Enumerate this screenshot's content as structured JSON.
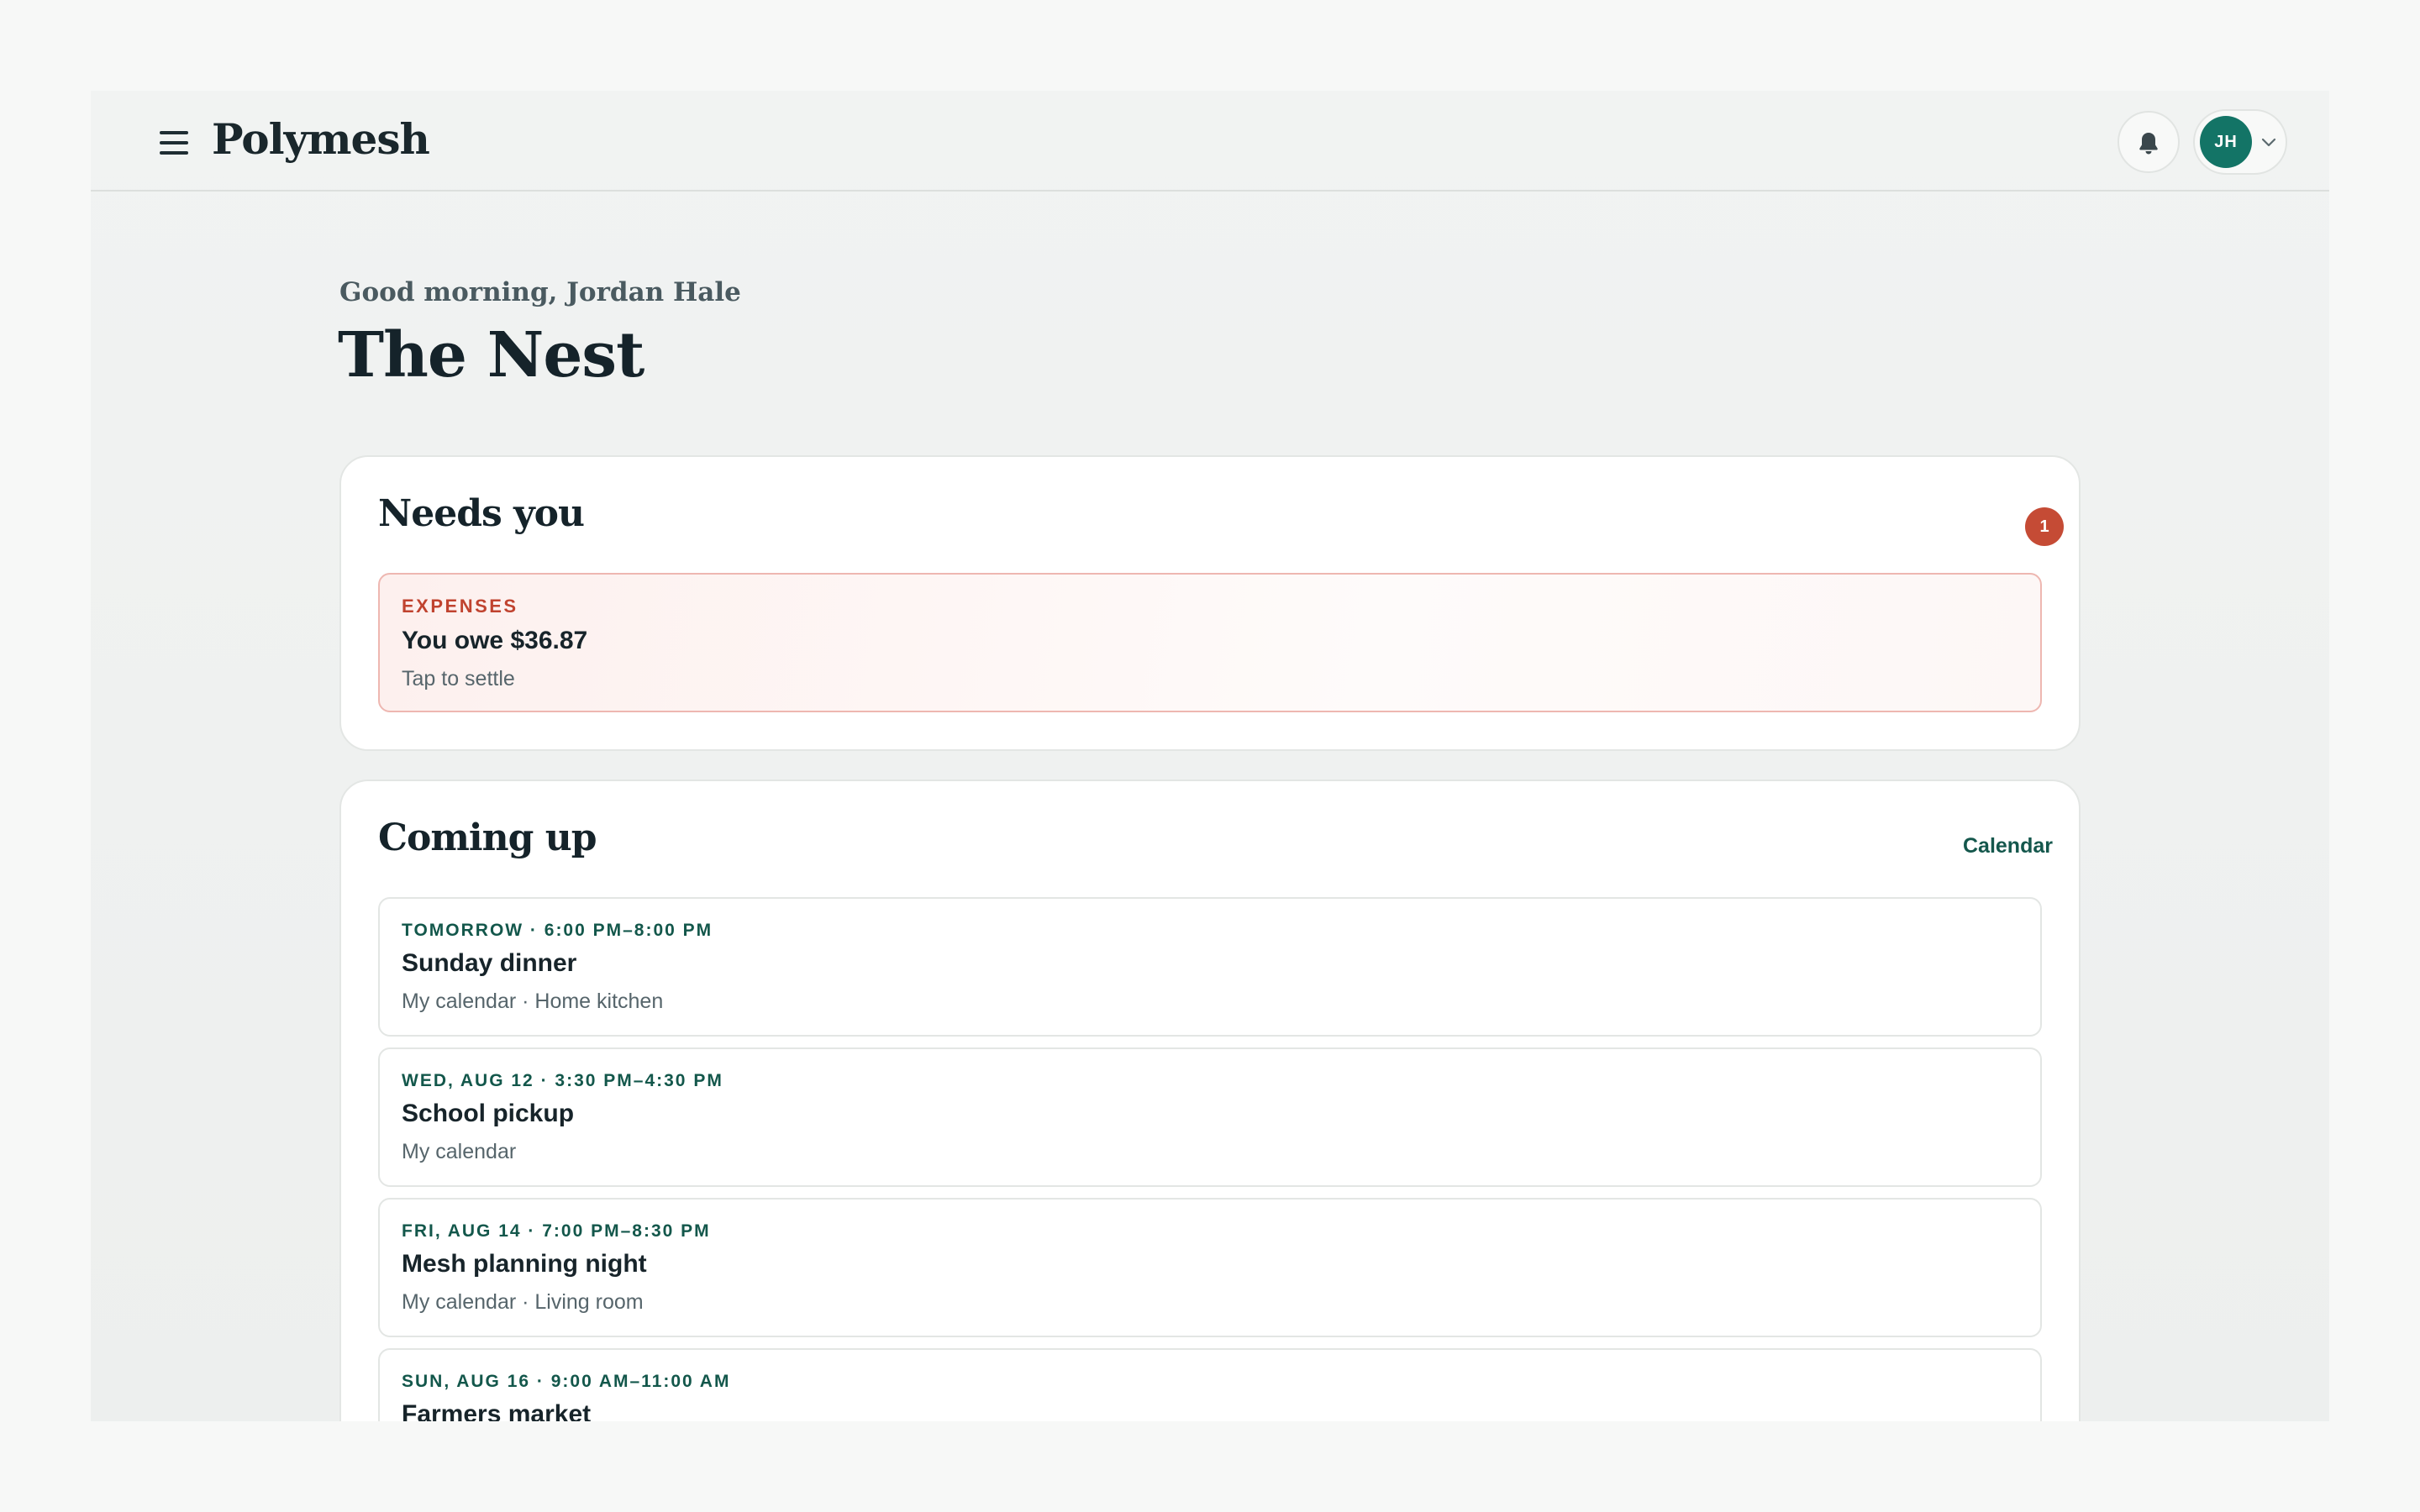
{
  "app": {
    "brand": "Polymesh"
  },
  "header": {
    "user_initials": "JH"
  },
  "page": {
    "greeting": "Good morning, Jordan Hale",
    "title": "The Nest"
  },
  "needs_you": {
    "title": "Needs you",
    "count": "1",
    "items": [
      {
        "category": "EXPENSES",
        "title": "You owe $36.87",
        "subtitle": "Tap to settle"
      }
    ]
  },
  "coming_up": {
    "title": "Coming up",
    "calendar_link": "Calendar",
    "events": [
      {
        "when": "TOMORROW · 6:00 PM–8:00 PM",
        "title": "Sunday dinner",
        "details": "My calendar · Home kitchen"
      },
      {
        "when": "WED, AUG 12 · 3:30 PM–4:30 PM",
        "title": "School pickup",
        "details": "My calendar"
      },
      {
        "when": "FRI, AUG 14 · 7:00 PM–8:30 PM",
        "title": "Mesh planning night",
        "details": "My calendar · Living room"
      },
      {
        "when": "SUN, AUG 16 · 9:00 AM–11:00 AM",
        "title": "Farmers market",
        "details": ""
      }
    ]
  },
  "colors": {
    "accent": "#137466",
    "alert": "#c54b35",
    "link": "#14574c"
  },
  "icons": {
    "menu": "hamburger-menu-icon",
    "notifications": "bell-icon",
    "account_dropdown": "chevron-down-icon"
  }
}
